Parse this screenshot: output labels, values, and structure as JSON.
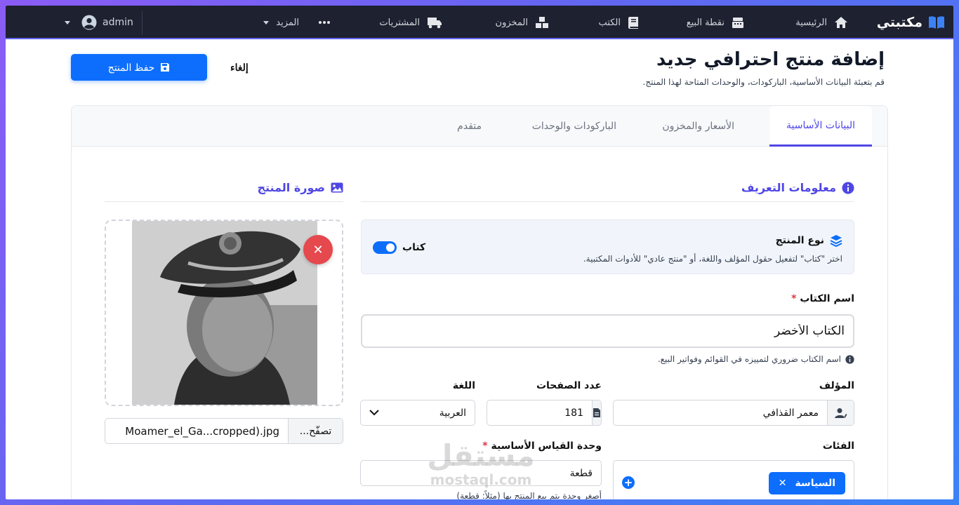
{
  "navbar": {
    "brand": "مكتبتي",
    "items": [
      {
        "label": "الرئيسية",
        "icon": "home-icon"
      },
      {
        "label": "نقطة البيع",
        "icon": "cash-register-icon"
      },
      {
        "label": "الكتب",
        "icon": "book-icon"
      },
      {
        "label": "المخزون",
        "icon": "boxes-icon"
      },
      {
        "label": "المشتريات",
        "icon": "truck-icon"
      },
      {
        "label": "المزيد",
        "icon": "ellipsis-icon"
      }
    ],
    "user": "admin"
  },
  "header": {
    "title": "إضافة منتج احترافي جديد",
    "subtitle": "قم بتعبئة البيانات الأساسية، الباركودات، والوحدات المتاحة لهذا المنتج.",
    "cancel_label": "إلغاء",
    "save_label": "حفظ المنتج"
  },
  "tabs": [
    {
      "label": "البيانات الأساسية",
      "active": true
    },
    {
      "label": "الأسعار والمخزون",
      "active": false
    },
    {
      "label": "الباركودات والوحدات",
      "active": false
    },
    {
      "label": "متقدم",
      "active": false
    }
  ],
  "identity": {
    "section_title": "معلومات التعريف",
    "product_type": {
      "title": "نوع المنتج",
      "description": "اختر \"كتاب\" لتفعيل حقول المؤلف واللغة، أو \"منتج عادي\" للأدوات المكتبية.",
      "toggle_label": "كتاب",
      "toggle_on": true
    },
    "book_name": {
      "label": "اسم الكتاب",
      "required_mark": "*",
      "value": "الكتاب الأخضر",
      "hint": "اسم الكتاب ضروري لتمييزه في القوائم وفواتير البيع."
    },
    "author": {
      "label": "المؤلف",
      "value": "معمر القذافي"
    },
    "pages": {
      "label": "عدد الصفحات",
      "value": "181"
    },
    "language": {
      "label": "اللغة",
      "value": "العربية"
    },
    "categories": {
      "label": "الفئات",
      "tags": [
        "السياسة"
      ]
    },
    "base_unit": {
      "label": "وحدة القياس الأساسية",
      "required_mark": "*",
      "value": "قطعة",
      "hint": "أصغر وحدة يتم بيع المنتج بها (مثلاً: قطعة)"
    }
  },
  "image": {
    "section_title": "صورة المنتج",
    "browse_label": "تصفّح...",
    "filename": "Moamer_el_Ga...cropped).jpg"
  },
  "watermark": {
    "top": "مستقل",
    "bottom": "mostaql.com"
  },
  "colors": {
    "accent": "#4f46e5",
    "primary": "#0d6efd",
    "danger": "#e5484d",
    "nav_bg": "#1e2130"
  }
}
